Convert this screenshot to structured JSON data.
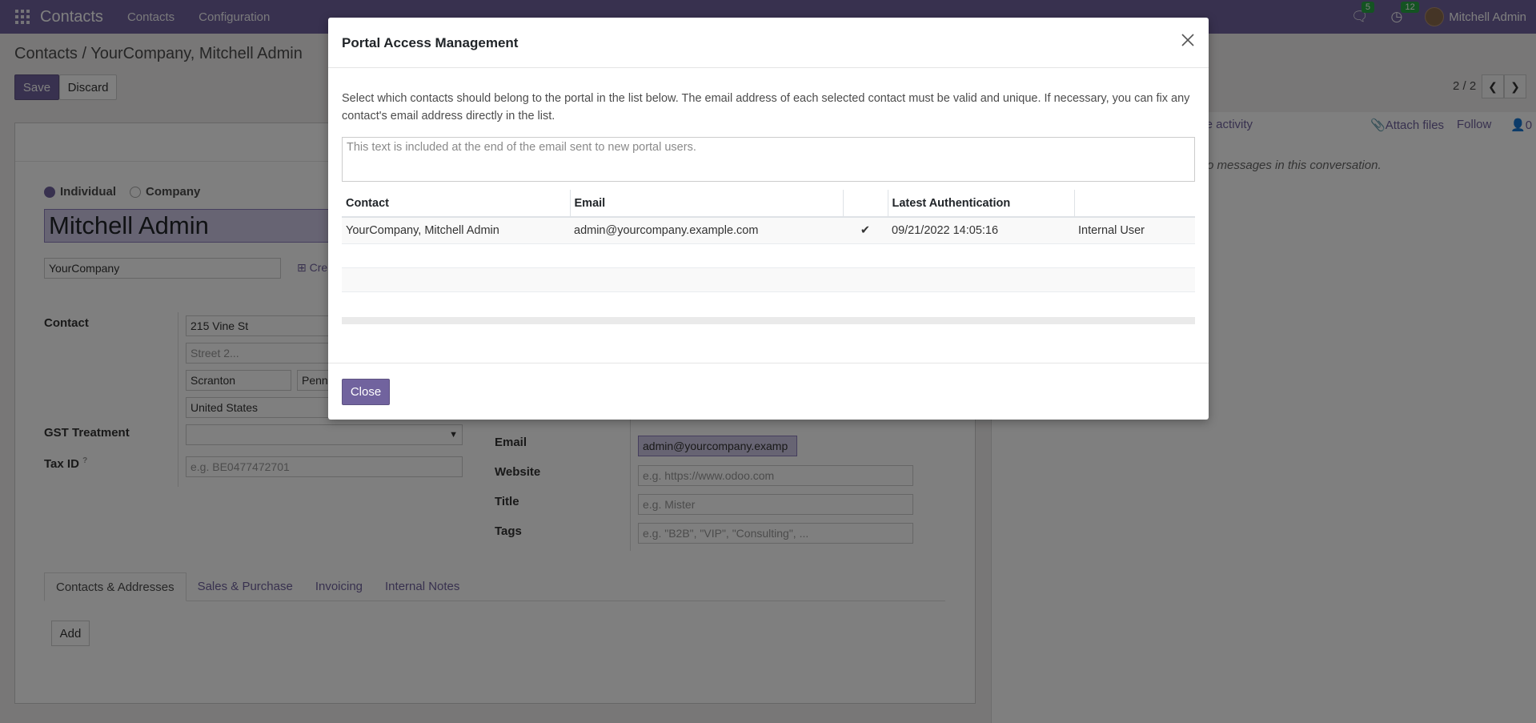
{
  "nav": {
    "brand": "Contacts",
    "links": [
      "Contacts",
      "Configuration"
    ],
    "messages_count": "5",
    "activities_count": "12",
    "user_name": "Mitchell Admin"
  },
  "control": {
    "breadcrumb_root": "Contacts",
    "breadcrumb_sep": "/",
    "breadcrumb_current": "YourCompany, Mitchell Admin",
    "save_label": "Save",
    "discard_label": "Discard",
    "pager": "2 / 2"
  },
  "form": {
    "type_individual": "Individual",
    "type_company": "Company",
    "name": "Mitchell Admin",
    "company": "YourCompany",
    "create_link": "Cre",
    "contact_label": "Contact",
    "street": "215 Vine St",
    "street2_placeholder": "Street 2...",
    "city": "Scranton",
    "state_partial": "Penn",
    "country": "United States",
    "gst_label": "GST Treatment",
    "taxid_label": "Tax ID",
    "taxid_help": "?",
    "taxid_placeholder": "e.g. BE0477472701",
    "email_label": "Email",
    "email_value": "admin@yourcompany.examp",
    "website_label": "Website",
    "website_placeholder": "e.g. https://www.odoo.com",
    "title_label": "Title",
    "title_placeholder": "e.g. Mister",
    "tags_label": "Tags",
    "tags_placeholder": "e.g. \"B2B\", \"VIP\", \"Consulting\", ...",
    "tabs": [
      "Contacts & Addresses",
      "Sales & Purchase",
      "Invoicing",
      "Internal Notes"
    ],
    "add_label": "Add"
  },
  "chatter": {
    "schedule_partial": "ule activity",
    "attach_label": "Attach files",
    "follow_label": "Follow",
    "followers_count": "0",
    "empty_partial": "o messages in this conversation."
  },
  "modal": {
    "title": "Portal Access Management",
    "intro": "Select which contacts should belong to the portal in the list below. The email address of each selected contact must be valid and unique. If necessary, you can fix any contact's email address directly in the list.",
    "textarea_placeholder": "This text is included at the end of the email sent to new portal users.",
    "columns": [
      "Contact",
      "Email",
      "",
      "Latest Authentication",
      ""
    ],
    "rows": [
      {
        "contact": "YourCompany, Mitchell Admin",
        "email": "admin@yourcompany.example.com",
        "latest": "09/21/2022 14:05:16",
        "role": "Internal User"
      }
    ],
    "close_label": "Close"
  },
  "colors": {
    "accent": "#71639e",
    "check": "#28a745"
  }
}
